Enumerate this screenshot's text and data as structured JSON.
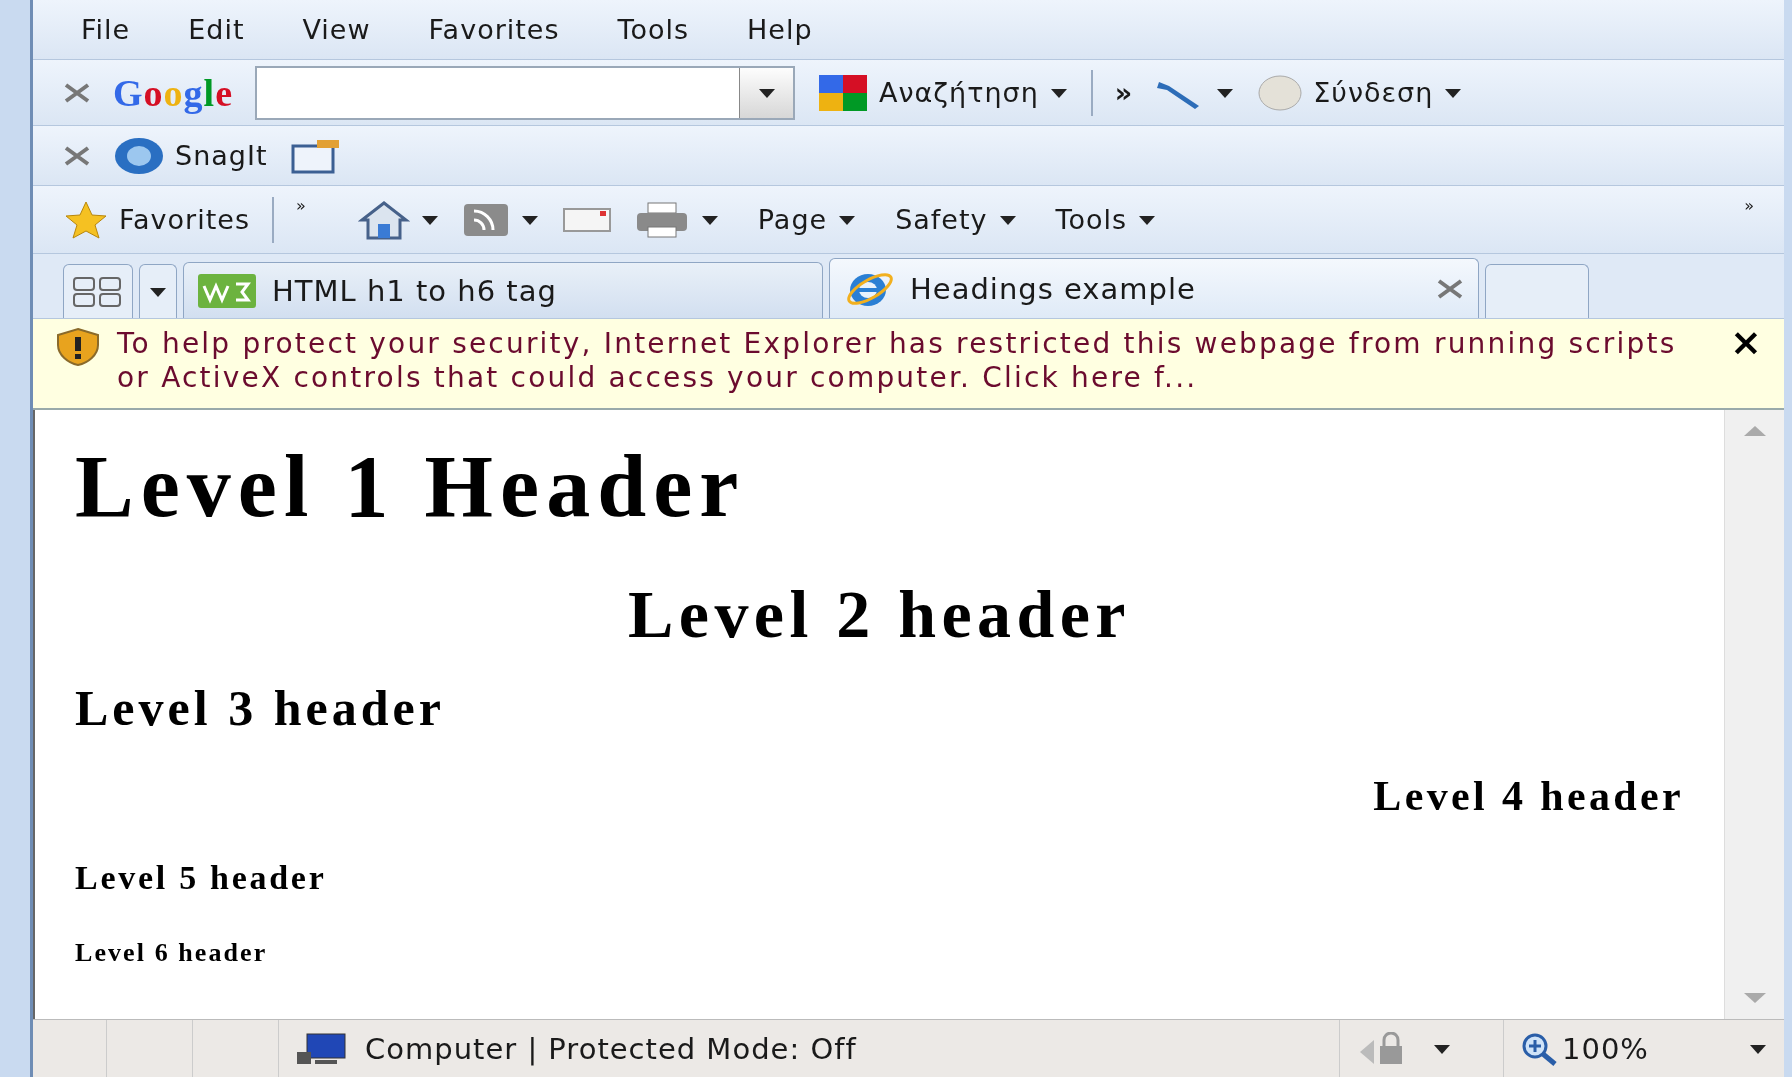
{
  "menu": [
    "File",
    "Edit",
    "View",
    "Favorites",
    "Tools",
    "Help"
  ],
  "google_bar": {
    "logo": "Google",
    "search_button": "Αναζήτηση",
    "more": "»",
    "sign_in": "Σύνδεση"
  },
  "links_bar": {
    "items": [
      "SnagIt"
    ]
  },
  "command_bar": {
    "favorites": "Favorites",
    "chevron_left": "»",
    "chevron_right": "»",
    "buttons": [
      "Page",
      "Safety",
      "Tools"
    ]
  },
  "tabs": [
    {
      "label": "HTML h1 to h6 tag",
      "selected": false,
      "kind": "w3"
    },
    {
      "label": "Headings example",
      "selected": true,
      "kind": "ie"
    }
  ],
  "info_bar": {
    "text": "To help protect your security, Internet Explorer has restricted this webpage from running scripts or ActiveX controls that could access your computer. Click here f...",
    "close": "×"
  },
  "headings": [
    {
      "kind": "h1",
      "text": "Level 1 Header",
      "centered": false,
      "right_aligned": false
    },
    {
      "kind": "h2",
      "text": "Level 2 header",
      "centered": true,
      "right_aligned": false
    },
    {
      "kind": "h3",
      "text": "Level 3 header",
      "centered": false,
      "right_aligned": false
    },
    {
      "kind": "h4",
      "text": "Level 4 header",
      "centered": false,
      "right_aligned": true
    },
    {
      "kind": "h5",
      "text": "Level 5 header",
      "centered": false,
      "right_aligned": false
    },
    {
      "kind": "h6",
      "text": "Level 6 header",
      "centered": false,
      "right_aligned": false
    }
  ],
  "status_bar": {
    "zone": "Computer | Protected Mode: Off",
    "zoom": "100%"
  }
}
